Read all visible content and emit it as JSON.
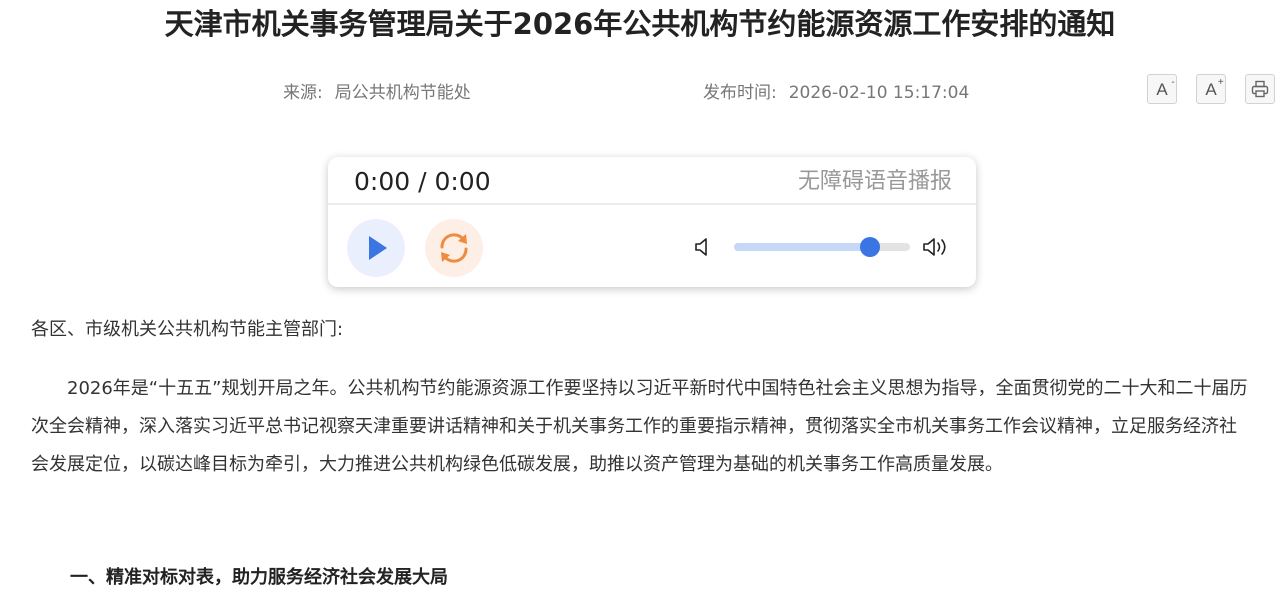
{
  "article": {
    "title": "天津市机关事务管理局关于2026年公共机构节约能源资源工作安排的通知",
    "source_label": "来源:",
    "source_value": "局公共机构节能处",
    "date_label": "发布时间:",
    "date_value": "2026-02-10 15:17:04",
    "salutation": "各区、市级机关公共机构节能主管部门:",
    "paragraph": "2026年是“十五五”规划开局之年。公共机构节约能源资源工作要坚持以习近平新时代中国特色社会主义思想为指导，全面贯彻党的二十大和二十届历次全会精神，深入落实习近平总书记视察天津重要讲话精神和关于机关事务工作的重要指示精神，贯彻落实全市机关事务工作会议精神，立足服务经济社会发展定位，以碳达峰目标为牵引，大力推进公共机构绿色低碳发展，助推以资产管理为基础的机关事务工作高质量发展。",
    "section_heading": "一、精准对标对表，助力服务经济社会发展大局"
  },
  "toolbar": {
    "font_decrease": {
      "glyph": "A",
      "mark": "-",
      "icon": "font-decrease-icon"
    },
    "font_increase": {
      "glyph": "A",
      "mark": "+",
      "icon": "font-increase-icon"
    },
    "print": {
      "icon": "printer-icon"
    }
  },
  "player": {
    "time": "0:00 / 0:00",
    "label": "无障碍语音播报",
    "volume": 0.77,
    "icons": [
      "play-icon",
      "replay-icon",
      "volume-low-icon",
      "volume-high-icon"
    ],
    "colors": {
      "play": "#3b74e3",
      "replay": "#f08a3e",
      "slider_thumb": "#3b74e3"
    }
  }
}
